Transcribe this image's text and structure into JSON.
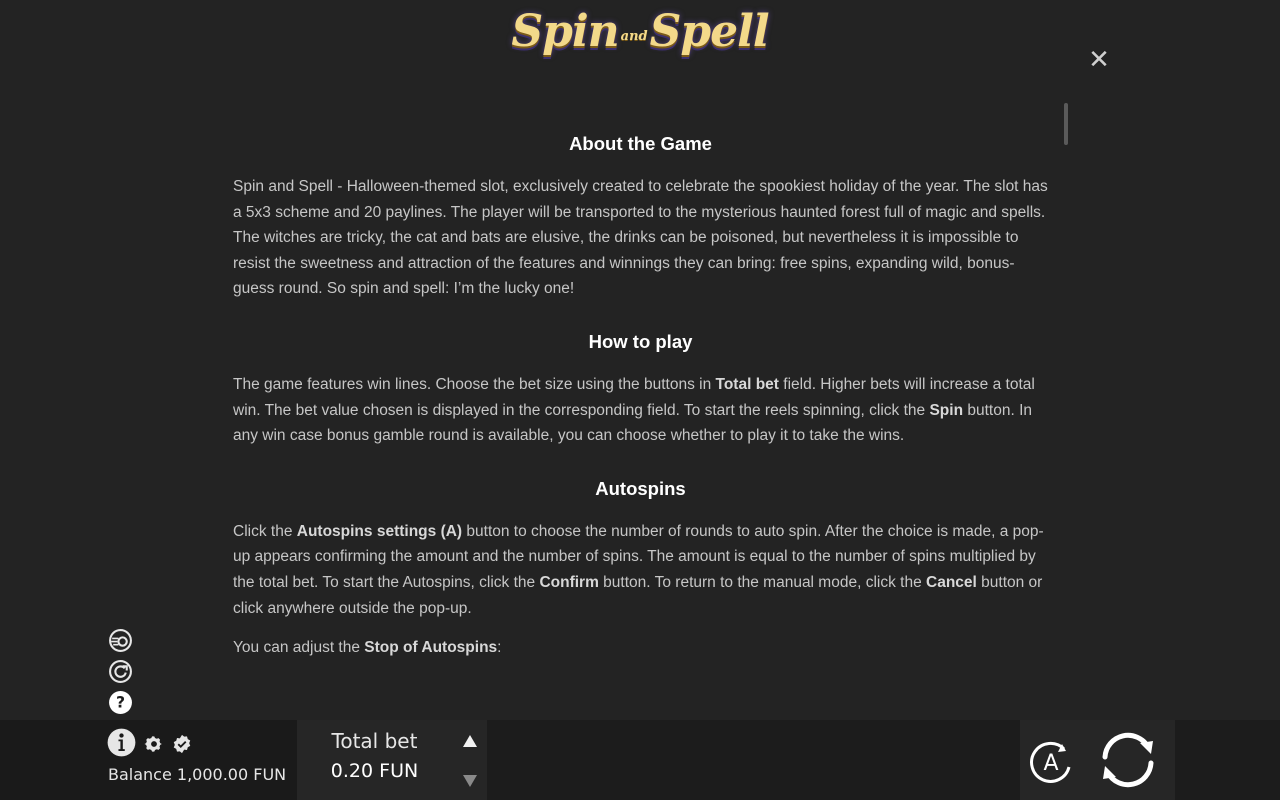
{
  "logo": {
    "word1": "Spin",
    "connector": "and",
    "word2": "Spell"
  },
  "icons": {
    "close": "close-icon",
    "turbo": "turbo-icon",
    "refresh": "refresh-icon",
    "help": "help-icon",
    "info": "info-icon",
    "settings": "gear-icon",
    "verified": "verified-badge-icon",
    "bet_up": "triangle-up-icon",
    "bet_down": "triangle-down-icon",
    "autospin": "autospin-icon",
    "spin": "spin-icon"
  },
  "close_glyph": "✕",
  "sections": {
    "about": {
      "title": "About the Game",
      "text": "Spin and Spell - Halloween-themed slot, exclusively created to celebrate the spookiest holiday of the year. The slot has a 5x3 scheme and 20 paylines. The player will be transported to the mysterious haunted forest full of magic and spells. The witches are tricky, the cat and bats are elusive, the drinks can be poisoned, but nevertheless it is impossible to resist the sweetness and attraction of the features and winnings they can bring: free spins, expanding wild, bonus-guess round. So spin and spell: I’m the lucky one!"
    },
    "how_to_play": {
      "title": "How to play",
      "t1": "The game features win lines. Choose the bet size using the buttons in ",
      "b1": "Total bet",
      "t2": " field. Higher bets will increase a total win. The bet value chosen is displayed in the corresponding field. To start the reels spinning, click the ",
      "b2": "Spin",
      "t3": " button. In any win case bonus gamble round is available, you can choose whether to play it to take the wins."
    },
    "autospins": {
      "title": "Autospins",
      "t1": "Click the ",
      "b1": "Autospins settings (A)",
      "t2": " button to choose the number of rounds to auto spin. After the choice is made, a pop-up appears confirming the amount and the number of spins. The amount is equal to the number of spins multiplied by the total bet. To start the Autospins, click the ",
      "b2": "Confirm",
      "t3": " button. To return to the manual mode, click the ",
      "b3": "Cancel",
      "t4": " button or click anywhere outside the pop-up.",
      "p2_t1": "You can adjust the ",
      "p2_b1": "Stop of Autospins",
      "p2_t2": ":"
    }
  },
  "bottom_bar": {
    "balance_label": "Balance",
    "balance_value": "1,000.00 FUN",
    "total_bet_label": "Total bet",
    "total_bet_value": "0.20 FUN",
    "autospin_letter": "A"
  },
  "colors": {
    "background": "#232323",
    "heading": "#ffffff",
    "body_text": "#c6c6c6",
    "logo_gold": "#f3d98a"
  }
}
